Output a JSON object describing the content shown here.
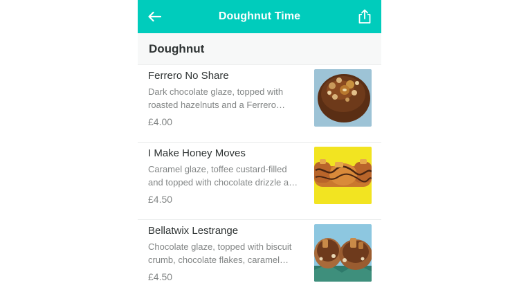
{
  "header": {
    "title": "Doughnut Time",
    "back_icon": "arrow-left-icon",
    "share_icon": "share-icon",
    "accent_color": "#00CCBC"
  },
  "section": {
    "title": "Doughnut"
  },
  "items": [
    {
      "name": "Ferrero No Share",
      "description": "Dark chocolate glaze, topped with roasted hazelnuts and a Ferrero Rocher",
      "price": "£4.00"
    },
    {
      "name": "I Make Honey Moves",
      "description": "Caramel glaze, toffee custard-filled and topped with chocolate drizzle and honeycomb",
      "price": "£4.50"
    },
    {
      "name": "Bellatwix Lestrange",
      "description": "Chocolate glaze, topped with biscuit crumb, chocolate flakes, caramel drizzle",
      "price": "£4.50"
    }
  ]
}
